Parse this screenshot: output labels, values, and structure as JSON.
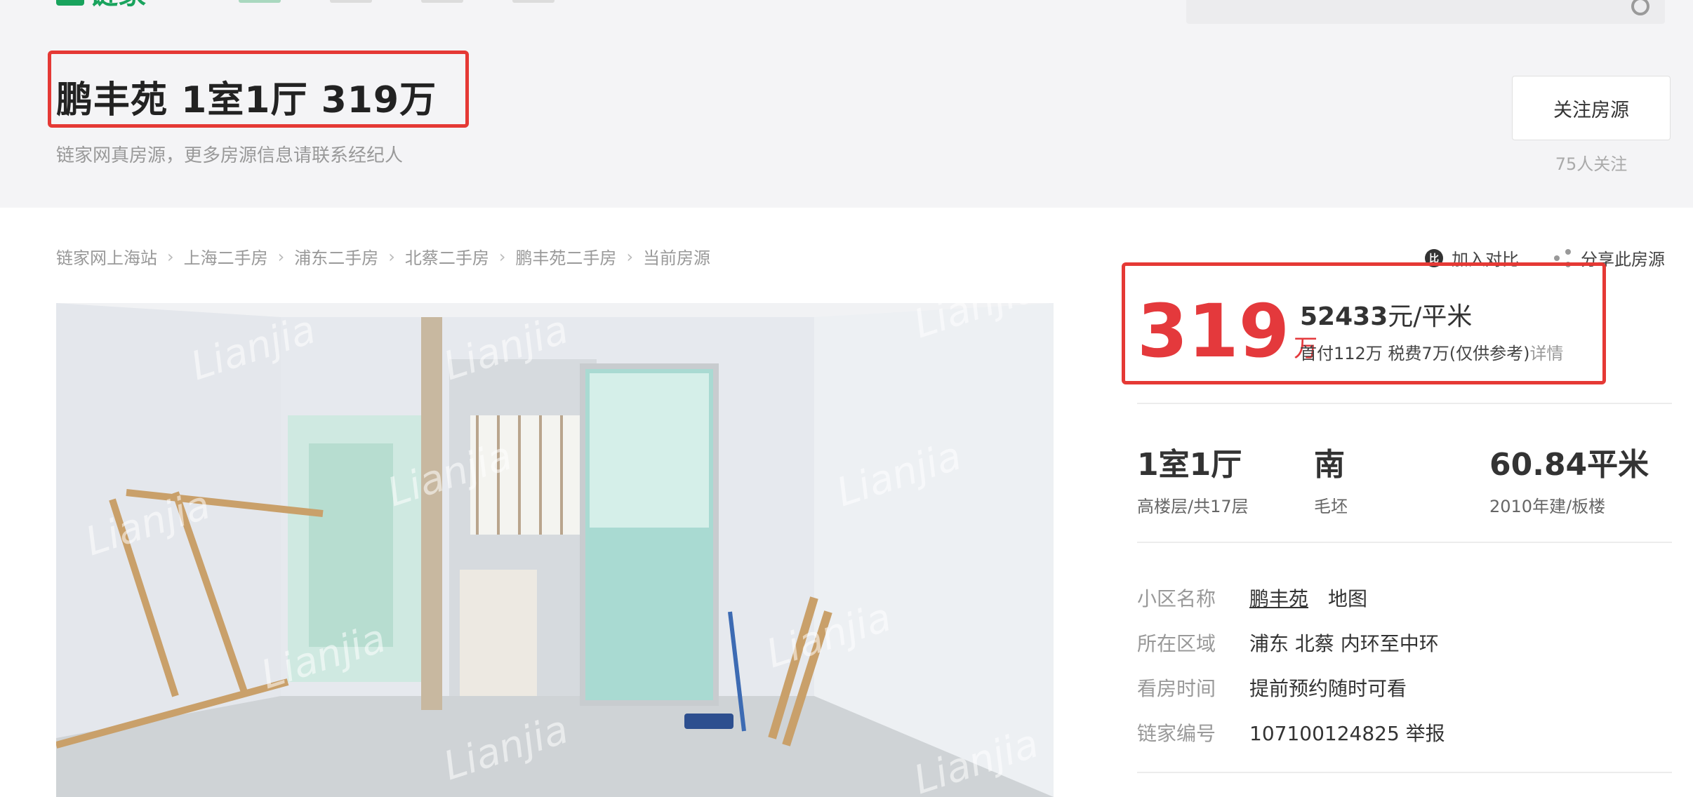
{
  "header": {
    "logo_text": "链家",
    "search_icon": "search-icon"
  },
  "listing": {
    "title": "鹏丰苑 1室1厅 319万",
    "subtitle": "链家网真房源，更多房源信息请联系经纪人",
    "follow_button": "关注房源",
    "follow_count": "75人关注"
  },
  "breadcrumb": [
    "链家网上海站",
    "上海二手房",
    "浦东二手房",
    "北蔡二手房",
    "鹏丰苑二手房",
    "当前房源"
  ],
  "actions": {
    "compare_label": "加入对比",
    "compare_icon_glyph": "比",
    "share_label": "分享此房源"
  },
  "photo": {
    "watermark": "Lianjia"
  },
  "price": {
    "total": "319",
    "total_unit": "万",
    "unit_price_value": "52433",
    "unit_price_unit": "元/平米",
    "tax_text": "首付112万 税费7万(仅供参考)",
    "tax_detail_link": "详情"
  },
  "facts": {
    "room_main": "1室1厅",
    "room_sub": "高楼层/共17层",
    "orientation_main": "南",
    "orientation_sub": "毛坯",
    "area_main": "60.84平米",
    "area_sub": "2010年建/板楼"
  },
  "info": {
    "community_label": "小区名称",
    "community_name": "鹏丰苑",
    "map_link": "地图",
    "district_label": "所在区域",
    "district_value": "浦东 北蔡 内环至中环",
    "viewing_label": "看房时间",
    "viewing_value": "提前预约随时可看",
    "id_label": "链家编号",
    "id_value": "107100124825 举报"
  },
  "colors": {
    "brand_green": "#19a35d",
    "price_red": "#e4393c",
    "highlight_red": "#e53935"
  }
}
